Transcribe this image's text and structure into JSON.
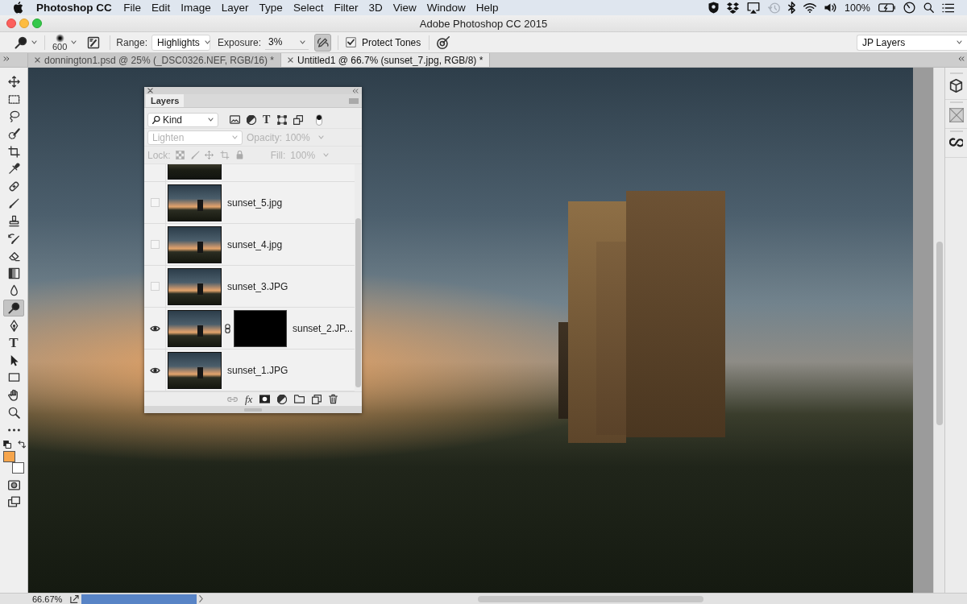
{
  "menu_bar": {
    "app_name": "Photoshop CC",
    "menus": [
      "File",
      "Edit",
      "Image",
      "Layer",
      "Type",
      "Select",
      "Filter",
      "3D",
      "View",
      "Window",
      "Help"
    ],
    "battery": "100%"
  },
  "window": {
    "title": "Adobe Photoshop CC 2015"
  },
  "options_bar": {
    "brush_size": "600",
    "range_label": "Range:",
    "range": "Highlights",
    "exposure_label": "Exposure:",
    "exposure": "3%",
    "airbrush_on": true,
    "protect_tones": {
      "label": "Protect Tones",
      "checked": true
    },
    "workspace": "JP Layers"
  },
  "tabs": [
    {
      "label": "donnington1.psd @ 25% (_DSC0326.NEF, RGB/16) *",
      "selected": false
    },
    {
      "label": "Untitled1 @ 66.7% (sunset_7.jpg, RGB/8) *",
      "selected": true
    }
  ],
  "tools": [
    {
      "kind": "move",
      "selected": false
    },
    {
      "kind": "marquee",
      "selected": false
    },
    {
      "kind": "lasso",
      "selected": false
    },
    {
      "kind": "quickselect",
      "selected": false
    },
    {
      "kind": "crop",
      "selected": false
    },
    {
      "kind": "eyedropper",
      "selected": false
    },
    {
      "kind": "healing",
      "selected": false
    },
    {
      "kind": "brush",
      "selected": false
    },
    {
      "kind": "stamp",
      "selected": false
    },
    {
      "kind": "historybrush",
      "selected": false
    },
    {
      "kind": "eraser",
      "selected": false
    },
    {
      "kind": "gradient",
      "selected": false
    },
    {
      "kind": "blur",
      "selected": false
    },
    {
      "kind": "dodge",
      "selected": true
    },
    {
      "kind": "pen",
      "selected": false
    },
    {
      "kind": "type",
      "glyph": "T",
      "selected": false
    },
    {
      "kind": "pathselect",
      "selected": false
    },
    {
      "kind": "rectangle",
      "selected": false
    },
    {
      "kind": "hand",
      "selected": false
    },
    {
      "kind": "zoom",
      "selected": false
    },
    {
      "kind": "more",
      "selected": false
    }
  ],
  "layers_panel": {
    "tab": {
      "label": "Layers",
      "selected": true
    },
    "filter": {
      "kind_label": "Kind",
      "type_glyph": "T",
      "enabled": true
    },
    "blend_mode": "Lighten",
    "opacity_label": "Opacity:",
    "opacity": "100%",
    "lock_label": "Lock:",
    "fill_label": "Fill:",
    "fill": "100%",
    "controls_disabled": true,
    "layers": [
      {
        "kind": "clipped",
        "selected": false
      },
      {
        "kind": "image",
        "name": "sunset_5.jpg",
        "visible": false,
        "selected": false
      },
      {
        "kind": "image",
        "name": "sunset_4.jpg",
        "visible": false,
        "selected": false
      },
      {
        "kind": "image",
        "name": "sunset_3.JPG",
        "visible": false,
        "selected": false
      },
      {
        "kind": "masked",
        "name": "sunset_2.JP...",
        "visible": true,
        "selected": false
      },
      {
        "kind": "image",
        "name": "sunset_1.JPG",
        "visible": true,
        "selected": false
      }
    ],
    "effects_label": "fx"
  },
  "status_bar": {
    "zoom": "66.67%"
  }
}
